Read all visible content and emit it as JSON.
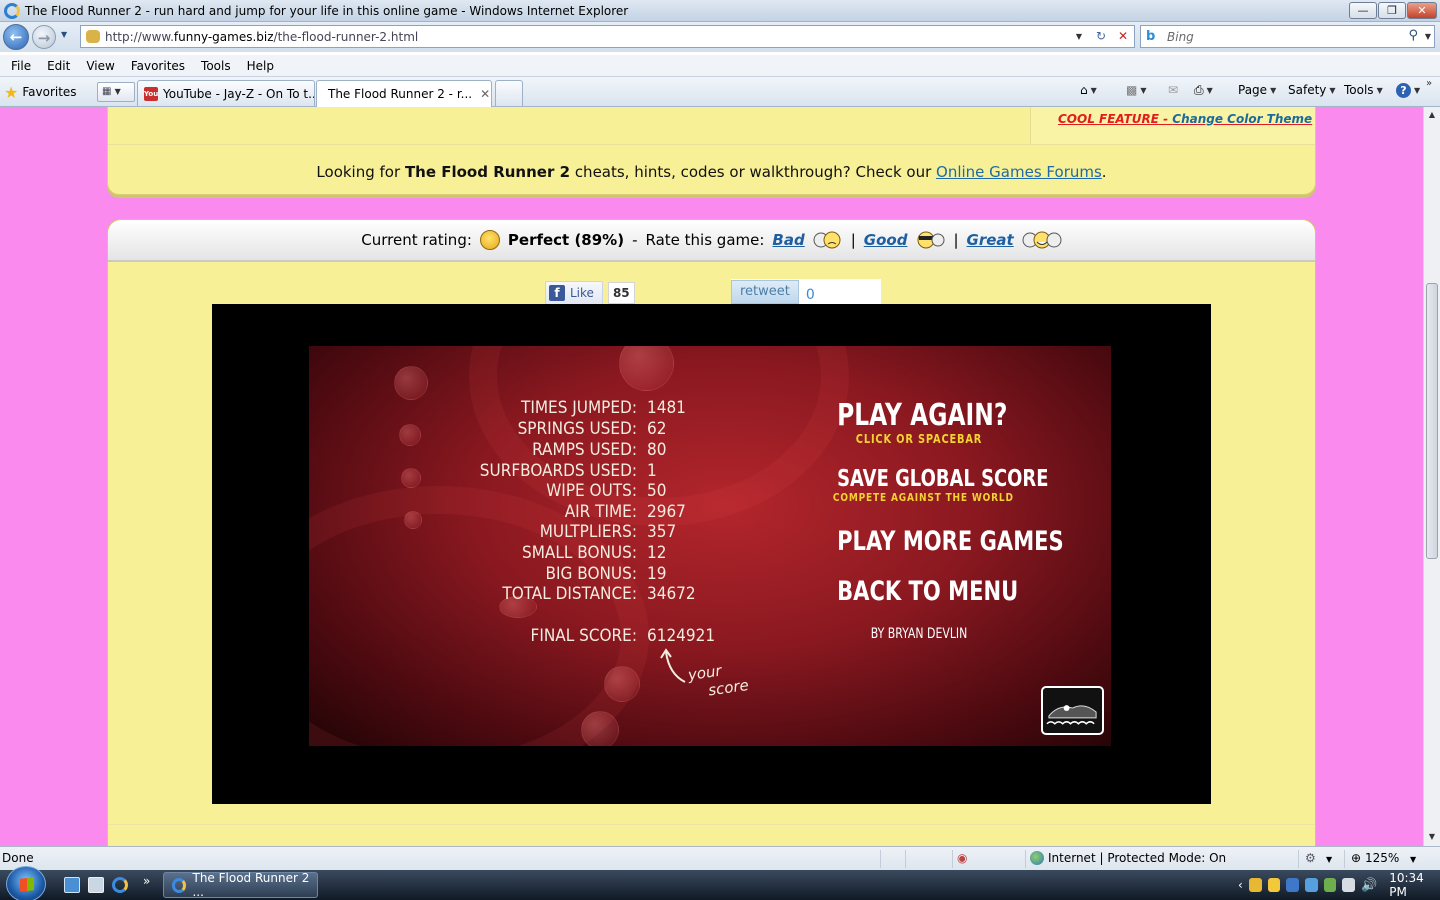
{
  "window": {
    "title": "The Flood Runner 2 - run hard and jump for your life in this online game - Windows Internet Explorer",
    "min": "—",
    "max": "❐",
    "close": "✕"
  },
  "address": {
    "prefix": "http://www.",
    "domain": "funny-games.biz",
    "path": "/the-flood-runner-2.html",
    "search_placeholder": "Bing"
  },
  "menu": [
    "File",
    "Edit",
    "View",
    "Favorites",
    "Tools",
    "Help"
  ],
  "tabs": {
    "favorites": "Favorites",
    "items": [
      {
        "label": "YouTube - Jay-Z - On To t...",
        "active": false
      },
      {
        "label": "The Flood Runner 2 - r...",
        "active": true
      }
    ]
  },
  "commands": {
    "page": "Page",
    "safety": "Safety",
    "tools": "Tools"
  },
  "page": {
    "cool_feature": "COOL FEATURE",
    "change_theme": "Change Color Theme",
    "cheats_prefix": "Looking for",
    "cheats_game": "The Flood Runner 2",
    "cheats_mid": "cheats, hints, codes or walkthrough? Check our",
    "cheats_link": "Online Games Forums",
    "cheats_end": ".",
    "rating_label": "Current rating:",
    "rating_value": "Perfect (89%)",
    "rate_label": "Rate this game:",
    "rate_bad": "Bad",
    "rate_good": "Good",
    "rate_great": "Great",
    "sep": "|",
    "dash": "-",
    "like_label": "Like",
    "like_count": "85",
    "retweet_label": "retweet",
    "retweet_count": "0"
  },
  "game": {
    "stats": [
      {
        "label": "TIMES JUMPED:",
        "value": "1481"
      },
      {
        "label": "SPRINGS USED:",
        "value": "62"
      },
      {
        "label": "RAMPS USED:",
        "value": "80"
      },
      {
        "label": "SURFBOARDS USED:",
        "value": "1"
      },
      {
        "label": "WIPE OUTS:",
        "value": "50"
      },
      {
        "label": "AIR TIME:",
        "value": "2967"
      },
      {
        "label": "MULTPLIERS:",
        "value": "357"
      },
      {
        "label": "SMALL BONUS:",
        "value": "12"
      },
      {
        "label": "BIG BONUS:",
        "value": "19"
      },
      {
        "label": "TOTAL DISTANCE:",
        "value": "34672"
      }
    ],
    "final_label": "FINAL SCORE:",
    "final_value": "6124921",
    "your_score_1": "your",
    "your_score_2": "score",
    "play_again": "PLAY AGAIN?",
    "play_again_sub": "CLICK OR SPACEBAR",
    "save_score": "SAVE GLOBAL SCORE",
    "save_score_sub": "COMPETE AGAINST THE WORLD",
    "more_games": "PLAY MORE GAMES",
    "back_menu": "BACK TO MENU",
    "credit": "BY BRYAN DEVLIN"
  },
  "status": {
    "left": "Done",
    "zone": "Internet | Protected Mode: On",
    "zoom": "125%"
  },
  "taskbar": {
    "item": "The Flood Runner 2 ...",
    "clock": "10:34 PM"
  }
}
